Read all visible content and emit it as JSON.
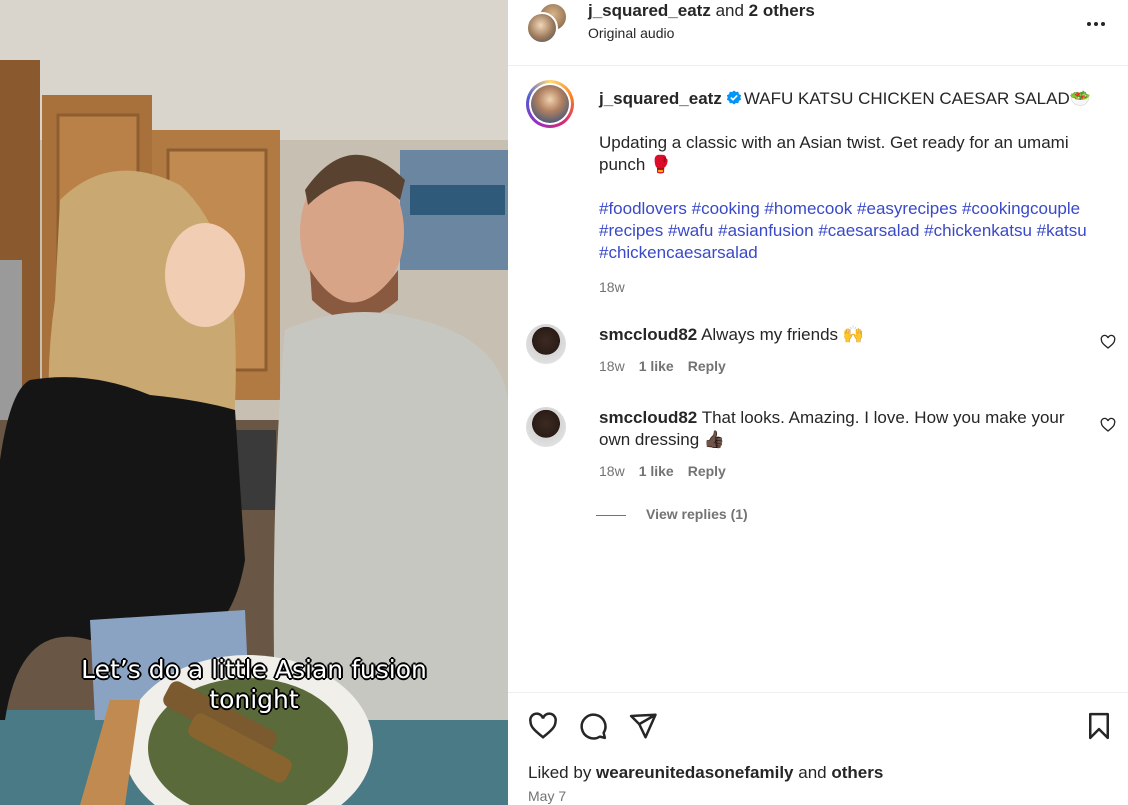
{
  "header": {
    "username": "j_squared_eatz",
    "and_text": " and ",
    "others": "2 others",
    "audio": "Original audio",
    "more_icon": "more-horizontal-icon"
  },
  "media": {
    "caption_line1": "Let’s do a little Asian fusion",
    "caption_line2": "tonight"
  },
  "post": {
    "username": "j_squared_eatz",
    "title": "WAFU KATSU CHICKEN CAESAR SALAD",
    "title_emoji": "🥗",
    "body": "Updating a classic with an Asian twist. Get ready for an umami punch",
    "body_emoji": "🥊",
    "hashtags": [
      "#foodlovers",
      "#cooking",
      "#homecook",
      "#easyrecipes",
      "#cookingcouple",
      "#recipes",
      "#wafu",
      "#asianfusion",
      "#caesarsalad",
      "#chickenkatsu",
      "#katsu",
      "#chickencaesarsalad"
    ],
    "age": "18w"
  },
  "comments": [
    {
      "username": "smccloud82",
      "text": "Always my friends",
      "emoji": "🙌",
      "age": "18w",
      "likes": "1 like",
      "reply": "Reply"
    },
    {
      "username": "smccloud82",
      "text": "That looks. Amazing. I love. How you make your own dressing",
      "emoji": "👍🏿",
      "age": "18w",
      "likes": "1 like",
      "reply": "Reply"
    }
  ],
  "view_replies": "View replies (1)",
  "footer": {
    "liked_by": "Liked by ",
    "liked_user": "weareunitedasonefamily",
    "and": " and ",
    "others": "others",
    "date": "May 7"
  },
  "colors": {
    "hashtag": "#3a49c8",
    "verified": "#0095f6",
    "muted": "#737373",
    "text": "#262626"
  }
}
